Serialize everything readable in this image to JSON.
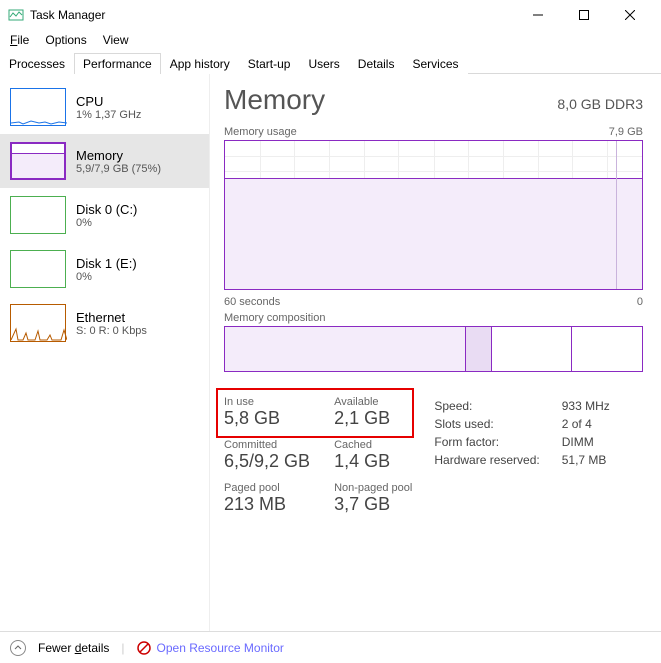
{
  "window": {
    "title": "Task Manager"
  },
  "menu": {
    "file": "File",
    "options": "Options",
    "view": "View"
  },
  "tabs": [
    "Processes",
    "Performance",
    "App history",
    "Start-up",
    "Users",
    "Details",
    "Services"
  ],
  "active_tab": "Performance",
  "sidebar": {
    "items": [
      {
        "title": "CPU",
        "sub": "1% 1,37 GHz"
      },
      {
        "title": "Memory",
        "sub": "5,9/7,9 GB (75%)"
      },
      {
        "title": "Disk 0 (C:)",
        "sub": "0%"
      },
      {
        "title": "Disk 1 (E:)",
        "sub": "0%"
      },
      {
        "title": "Ethernet",
        "sub": "S: 0 R: 0 Kbps"
      }
    ]
  },
  "main": {
    "title": "Memory",
    "spec": "8,0 GB DDR3",
    "usage_label": "Memory usage",
    "usage_max": "7,9 GB",
    "time_left": "60 seconds",
    "time_right": "0",
    "composition_label": "Memory composition"
  },
  "stats": {
    "in_use_label": "In use",
    "in_use": "5,8 GB",
    "available_label": "Available",
    "available": "2,1 GB",
    "committed_label": "Committed",
    "committed": "6,5/9,2 GB",
    "cached_label": "Cached",
    "cached": "1,4 GB",
    "paged_label": "Paged pool",
    "paged": "213 MB",
    "nonpaged_label": "Non-paged pool",
    "nonpaged": "3,7 GB"
  },
  "hw": {
    "speed_label": "Speed:",
    "speed": "933 MHz",
    "slots_label": "Slots used:",
    "slots": "2 of 4",
    "form_label": "Form factor:",
    "form": "DIMM",
    "reserved_label": "Hardware reserved:",
    "reserved": "51,7 MB"
  },
  "footer": {
    "fewer": "Fewer details",
    "orm": "Open Resource Monitor"
  },
  "chart_data": {
    "type": "area",
    "title": "Memory usage",
    "xlabel": "seconds",
    "ylabel": "GB",
    "ylim": [
      0,
      7.9
    ],
    "x_range": [
      60,
      0
    ],
    "series": [
      {
        "name": "In use",
        "values": [
          5.9,
          5.9,
          5.9,
          5.9,
          5.9,
          5.9,
          5.9,
          5.9,
          5.9,
          5.9,
          5.9,
          5.9,
          5.9
        ]
      }
    ]
  }
}
